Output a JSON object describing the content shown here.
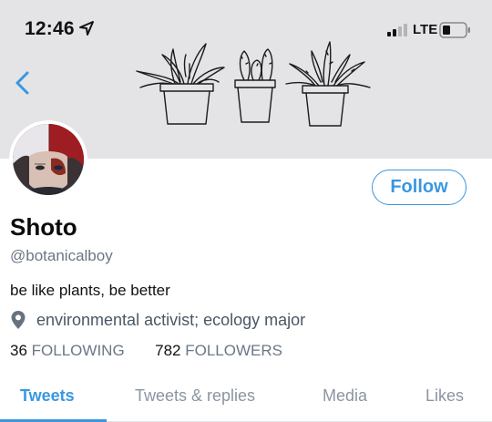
{
  "status_bar": {
    "time": "12:46",
    "network": "LTE"
  },
  "profile": {
    "name": "Shoto",
    "handle": "@botanicalboy",
    "bio": "be like plants, be better",
    "location": "environmental activist; ecology major",
    "following_count": "36",
    "following_label": "FOLLOWING",
    "followers_count": "782",
    "followers_label": "FOLLOWERS"
  },
  "actions": {
    "follow_label": "Follow"
  },
  "tabs": [
    {
      "label": "Tweets",
      "active": true
    },
    {
      "label": "Tweets & replies",
      "active": false
    },
    {
      "label": "Media",
      "active": false
    },
    {
      "label": "Likes",
      "active": false
    }
  ],
  "colors": {
    "accent": "#3a97e0",
    "banner": "#e4e4e6",
    "muted": "#6b7785"
  }
}
